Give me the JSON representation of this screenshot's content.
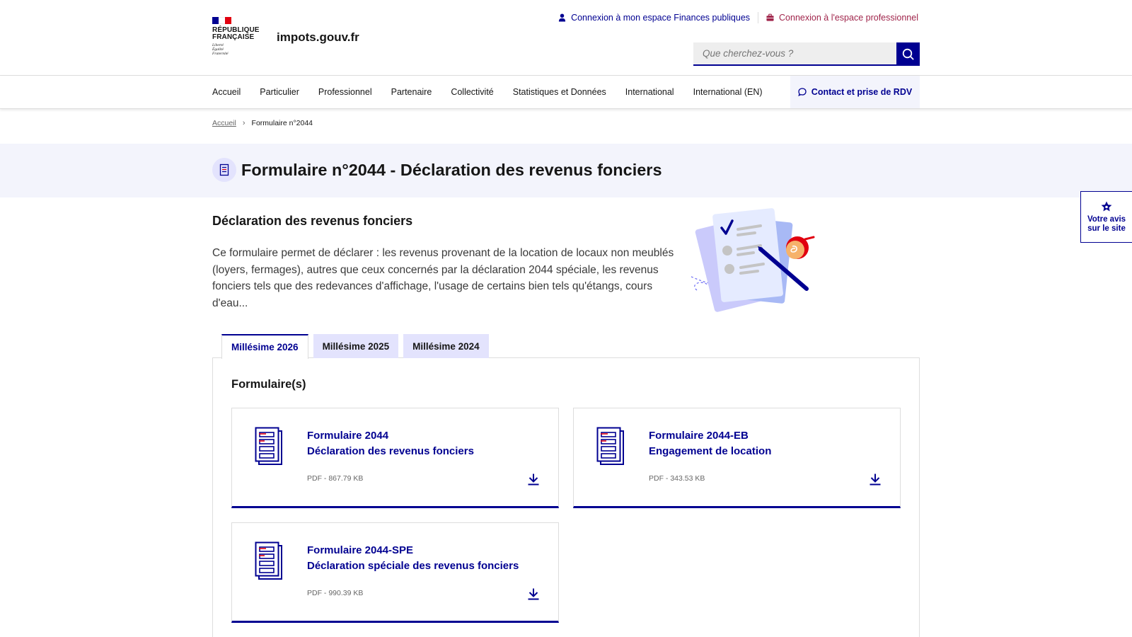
{
  "header": {
    "logo_line1": "RÉPUBLIQUE",
    "logo_line2": "FRANÇAISE",
    "motto1": "Liberté",
    "motto2": "Égalité",
    "motto3": "Fraternité",
    "site_name": "impots.gouv.fr",
    "link_particulier": "Connexion à mon espace Finances publiques",
    "link_pro": "Connexion à l'espace professionnel",
    "search_placeholder": "Que cherchez-vous ?"
  },
  "nav": {
    "items": [
      "Accueil",
      "Particulier",
      "Professionnel",
      "Partenaire",
      "Collectivité",
      "Statistiques et Données",
      "International",
      "International (EN)"
    ],
    "contact": "Contact et prise de RDV"
  },
  "breadcrumb": {
    "home": "Accueil",
    "current": "Formulaire n°2044"
  },
  "page": {
    "title": "Formulaire n°2044 - Déclaration des revenus fonciers",
    "section_heading": "Déclaration des revenus fonciers",
    "intro": "Ce formulaire permet de déclarer : les revenus provenant de la location de locaux non meublés (loyers, fermages), autres que ceux concernés par la déclaration 2044 spéciale, les revenus fonciers tels que des redevances d'affichage, l'usage de certains bien tels qu'étangs, cours d'eau..."
  },
  "feedback": {
    "line1": "Votre avis",
    "line2": "sur le site"
  },
  "tabs": [
    "Millésime 2026",
    "Millésime 2025",
    "Millésime 2024"
  ],
  "panel": {
    "title": "Formulaire(s)",
    "cards": [
      {
        "code": "Formulaire 2044",
        "name": "Déclaration des revenus fonciers",
        "meta": "PDF - 867.79 KB"
      },
      {
        "code": "Formulaire 2044-EB",
        "name": "Engagement de location",
        "meta": "PDF - 343.53 KB"
      },
      {
        "code": "Formulaire 2044-SPE",
        "name": "Déclaration spéciale des revenus fonciers",
        "meta": "PDF - 990.39 KB"
      }
    ]
  },
  "colors": {
    "brand_blue": "#000091",
    "marianne_red": "#e1000f",
    "pro_link": "#a0254b",
    "band_bg": "#f3f4fc",
    "tab_bg": "#e3e3fd"
  }
}
